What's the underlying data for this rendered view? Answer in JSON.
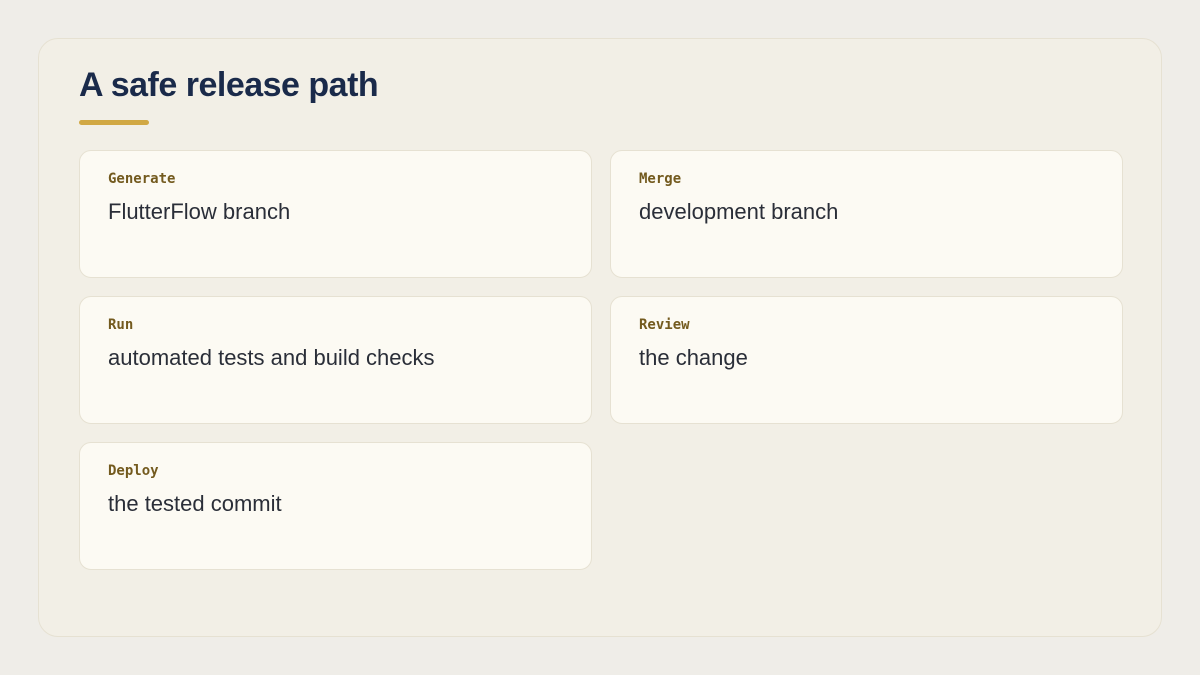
{
  "title": "A safe release path",
  "colors": {
    "background": "#efede8",
    "panel": "#f2efe6",
    "card": "#fcfaf3",
    "title": "#1a2a4a",
    "accent": "#d1a844",
    "verb": "#735a1e",
    "text": "#2a2e38"
  },
  "steps": [
    {
      "verb": "Generate",
      "text": "FlutterFlow branch"
    },
    {
      "verb": "Merge",
      "text": "development branch"
    },
    {
      "verb": "Run",
      "text": "automated tests and build checks"
    },
    {
      "verb": "Review",
      "text": "the change"
    },
    {
      "verb": "Deploy",
      "text": "the tested commit"
    }
  ]
}
